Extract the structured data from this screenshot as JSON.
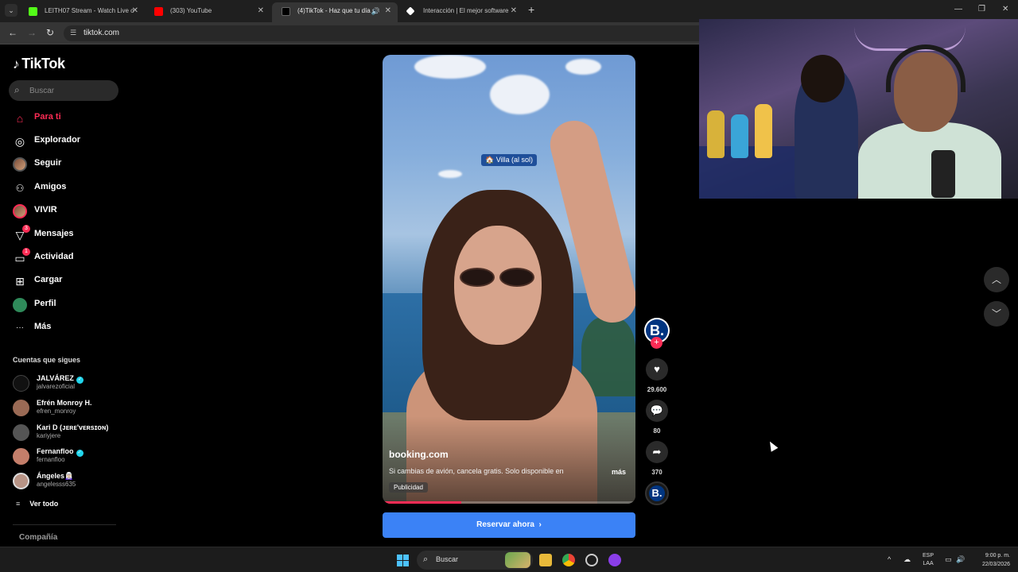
{
  "browser": {
    "tabs": [
      {
        "title": "LEITH07 Stream - Watch Live o",
        "favicon_color": "#53fc18"
      },
      {
        "title": "(303) YouTube",
        "favicon_color": "#ff0000"
      },
      {
        "title": "(4)TikTok - Haz que tu día s",
        "favicon_color": "#000000"
      },
      {
        "title": "Interacción | El mejor software ",
        "favicon_color": "#ffffff"
      }
    ],
    "url": "tiktok.com"
  },
  "sidebar": {
    "logo": "TikTok",
    "search_placeholder": "Buscar",
    "nav": [
      {
        "label": "Para ti",
        "icon": "home-icon",
        "glyph": "⌂"
      },
      {
        "label": "Explorador",
        "icon": "compass-icon",
        "glyph": "◎"
      },
      {
        "label": "Seguir",
        "icon": "following-avatar-icon",
        "glyph": ""
      },
      {
        "label": "Amigos",
        "icon": "friends-icon",
        "glyph": "👥"
      },
      {
        "label": "VIVIR",
        "icon": "live-avatar-icon",
        "glyph": ""
      },
      {
        "label": "Mensajes",
        "icon": "messages-icon",
        "glyph": "▽",
        "badge": "3"
      },
      {
        "label": "Actividad",
        "icon": "activity-icon",
        "glyph": "▭",
        "badge": "1"
      },
      {
        "label": "Cargar",
        "icon": "upload-icon",
        "glyph": "⊞"
      },
      {
        "label": "Perfil",
        "icon": "profile-avatar-icon",
        "glyph": ""
      },
      {
        "label": "Más",
        "icon": "more-icon",
        "glyph": "···"
      }
    ],
    "following_title": "Cuentas que sigues",
    "following": [
      {
        "name": "JALVÁREZ",
        "user": "jalvarezoficial",
        "verified": true,
        "avatar_color": "#111111"
      },
      {
        "name": "Efrén Monroy H.",
        "user": "efren_monroy",
        "verified": false,
        "avatar_color": "#9a6a55"
      },
      {
        "name": "Kari D (ᴊᴇʀᴇ'ᴠᴇʀsɪᴏɴ)",
        "user": "kariyjere",
        "verified": false,
        "avatar_color": "#555555"
      },
      {
        "name": "Fernanfloo",
        "user": "fernanfloo",
        "verified": true,
        "avatar_color": "#c47e6a"
      },
      {
        "name": "Ángeles🧝🏻‍♀️",
        "user": "angelesss635",
        "verified": false,
        "avatar_color": "#b89486"
      }
    ],
    "see_all": "Ver todo",
    "company": "Compañía"
  },
  "video": {
    "location_chip": "🏠 Villa (al sol)",
    "author": "booking.com",
    "caption": "Si cambias de avión, cancela gratis. Solo disponible en",
    "more": "más",
    "ad_label": "Publicidad",
    "progress_fraction": 0.31,
    "cta": "Reservar ahora",
    "cta_chevron": "›"
  },
  "actions": {
    "avatar_letter": "B.",
    "likes": "29.600",
    "comments": "80",
    "shares": "370"
  },
  "taskbar": {
    "search_label": "Buscar",
    "lang_line1": "ESP",
    "lang_line2": "LAA",
    "time": "9:00 p. m.",
    "date": "22/03/2026"
  }
}
